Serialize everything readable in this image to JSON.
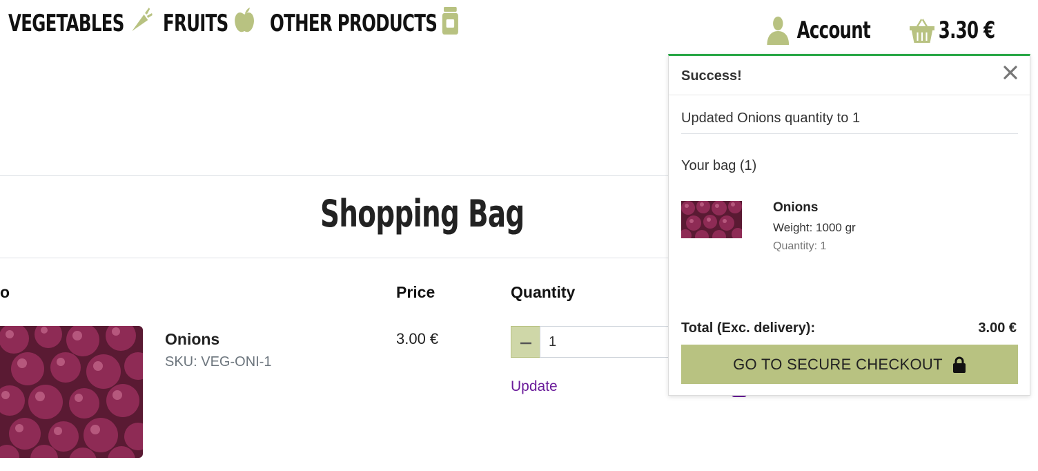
{
  "nav": {
    "vegetables": "VEGETABLES",
    "fruits": "FRUITS",
    "other": "OTHER PRODUCTS"
  },
  "header": {
    "account": "Account",
    "bag_total": "3.30 €"
  },
  "page": {
    "title": "Shopping Bag",
    "columns": {
      "product_partial": "o",
      "price": "Price",
      "quantity": "Quantity"
    }
  },
  "item": {
    "name": "Onions",
    "sku": "SKU: VEG-ONI-1",
    "price": "3.00 €",
    "quantity": "1",
    "update_label": "Update"
  },
  "toast": {
    "title": "Success!",
    "message": "Updated Onions quantity to 1",
    "bag_count": "Your bag (1)",
    "item_name": "Onions",
    "item_weight": "Weight: 1000 gr",
    "item_qty": "Quantity: 1",
    "total_label": "Total (Exc. delivery):",
    "total_value": "3.00 €",
    "checkout_label": "GO TO SECURE CHECKOUT"
  },
  "colors": {
    "accent_green": "#b8c281",
    "success_border": "#28a745",
    "link_purple": "#6a1b9a",
    "onion_purple": "#7b2347"
  },
  "icons": [
    "carrot-icon",
    "apple-icon",
    "jar-icon",
    "user-icon",
    "basket-icon",
    "minus-icon",
    "close-icon",
    "lock-icon"
  ]
}
